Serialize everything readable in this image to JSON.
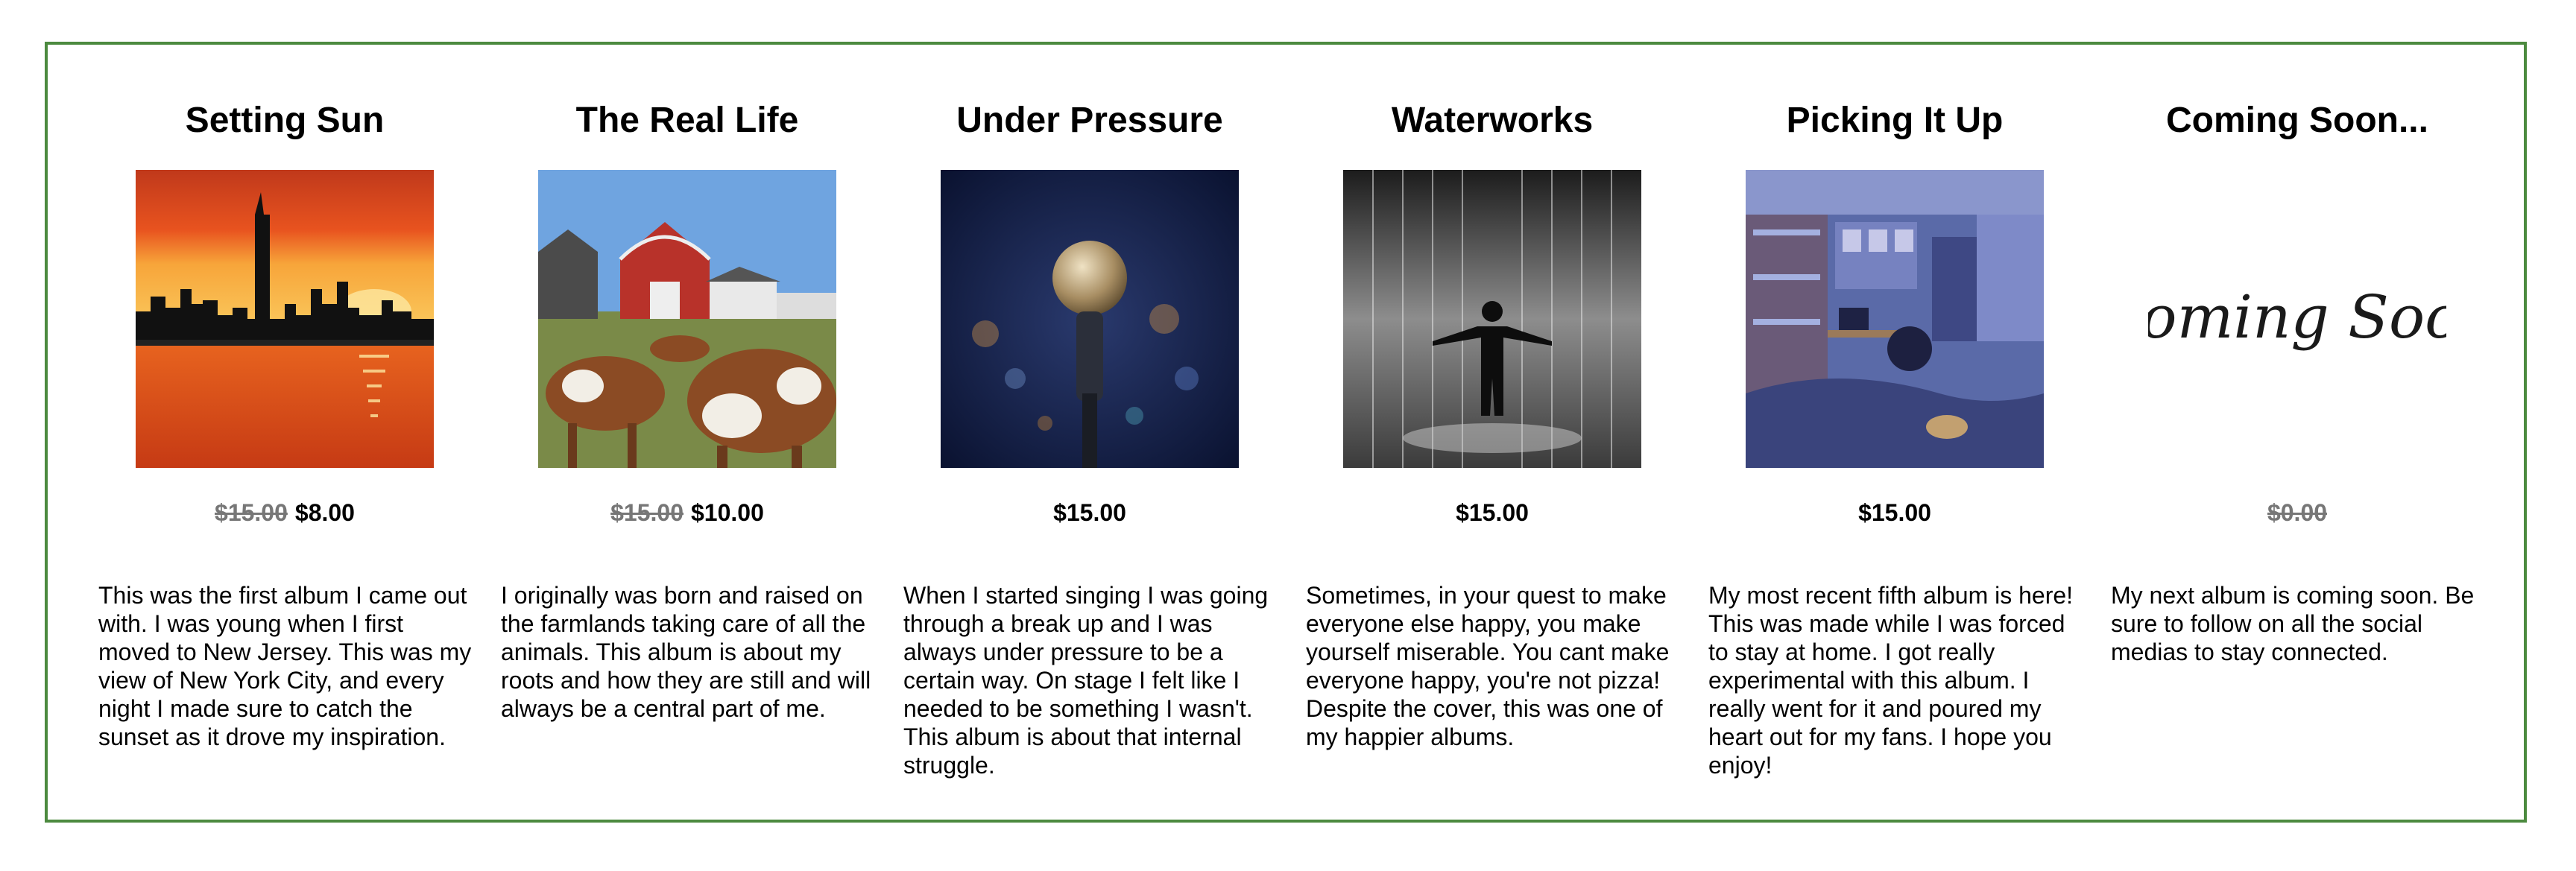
{
  "albums": [
    {
      "title": "Setting Sun",
      "cover_icon": "city-sunset-image",
      "price_old": "$15.00",
      "price_new": "$8.00",
      "description": "This was the first album I came out with. I was young when I first moved to New Jersey. This was my view of New York City, and every night I made sure to catch the sunset as it drove my inspiration."
    },
    {
      "title": "The Real Life",
      "cover_icon": "farm-cows-image",
      "price_old": "$15.00",
      "price_new": "$10.00",
      "description": "I originally was born and raised on the farmlands taking care of all the animals. This album is about my roots and how they are still and will always be a central part of me."
    },
    {
      "title": "Under Pressure",
      "cover_icon": "microphone-image",
      "price_old": "",
      "price_new": "$15.00",
      "description": "When I started singing I was going through a break up and I was always under pressure to be a certain way. On stage I felt like I needed to be something I wasn't. This album is about that internal struggle."
    },
    {
      "title": "Waterworks",
      "cover_icon": "rain-person-image",
      "price_old": "",
      "price_new": "$15.00",
      "description": "Sometimes, in your quest to make everyone else happy, you make yourself miserable. You cant make everyone happy, you're not pizza! Despite the cover, this was one of my happier albums."
    },
    {
      "title": "Picking It Up",
      "cover_icon": "bedroom-image",
      "price_old": "",
      "price_new": "$15.00",
      "description": "My most recent fifth album is here! This was made while I was forced to stay at home. I got really experimental with this album. I really went for it and poured my heart out for my fans. I hope you enjoy!"
    },
    {
      "title": "Coming Soon...",
      "cover_icon": "coming-soon-image",
      "cover_text": "Coming Soon",
      "price_old": "$0.00",
      "price_new": "",
      "description": "My next album is coming soon. Be sure to follow on all the social medias to stay connected."
    }
  ],
  "colors": {
    "frame_border": "#4c8a3f",
    "strikethrough_price": "#777777"
  }
}
